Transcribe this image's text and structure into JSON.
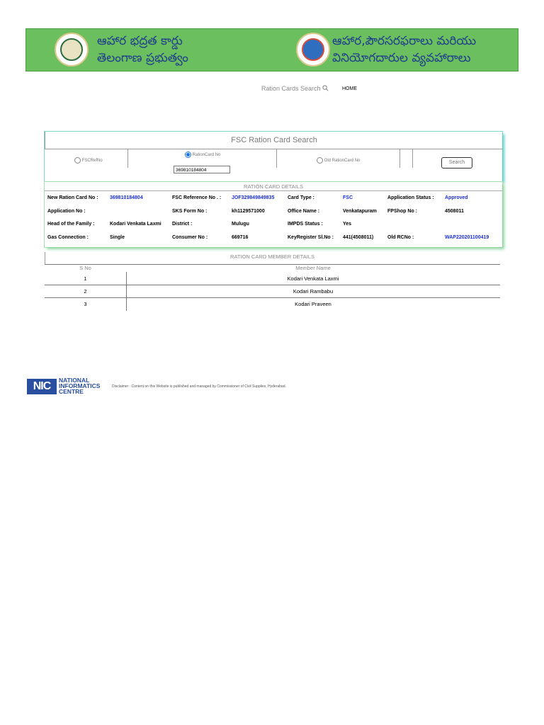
{
  "banner": {
    "left_title_line1": "ఆహార భద్రత కార్డు",
    "left_title_line2": "తెలంగాణ ప్రభుత్వం",
    "right_title_line1": "ఆహార,పౌరసరఫరాలు మరియు",
    "right_title_line2": "వినియోగదారుల వ్యవహారాలు",
    "bg_color": "#6bbf5f",
    "text_color": "#1f3d8c"
  },
  "nav": {
    "search_label": "Ration Cards Search",
    "search_icon": "search-icon",
    "home_label": "HOME"
  },
  "search_panel": {
    "title": "FSC Ration Card Search",
    "options": [
      {
        "label": "FSCRefNo",
        "selected": false
      },
      {
        "label": "RationCard No",
        "selected": true
      },
      {
        "label": "Old RationCard No",
        "selected": false
      }
    ],
    "input_value": "369810184804",
    "search_button": "Search"
  },
  "details": {
    "title": "RATION CARD DETAILS",
    "rows": [
      [
        {
          "label": "New Ration Card No :",
          "value": "369810184804",
          "blue": true
        },
        {
          "label": "FSC Reference No . :",
          "value": "JOF329849849835",
          "blue": true
        },
        {
          "label": "Card Type :",
          "value": "FSC",
          "blue": true
        },
        {
          "label": "Application Status :",
          "value": "Approved",
          "blue": true
        }
      ],
      [
        {
          "label": "Application No :",
          "value": ""
        },
        {
          "label": "SKS Form No :",
          "value": "kh1129571000"
        },
        {
          "label": "Office Name :",
          "value": "Venkatapuram"
        },
        {
          "label": "FPShop No :",
          "value": "4508011"
        }
      ],
      [
        {
          "label": "Head of the Family :",
          "value": "Kodari Venkata Laxmi"
        },
        {
          "label": "District :",
          "value": "Mulugu"
        },
        {
          "label": "IMPDS Status :",
          "value": "Yes"
        },
        {
          "label": "",
          "value": ""
        }
      ],
      [
        {
          "label": "Gas Connection :",
          "value": "Single"
        },
        {
          "label": "Consumer No :",
          "value": "669716"
        },
        {
          "label": "KeyRegister Sl.No :",
          "value": "441(4508011)"
        },
        {
          "label": "Old RCNo :",
          "value": "WAP220201100419",
          "blue": true
        }
      ]
    ]
  },
  "members": {
    "title": "RATION CARD MEMBER DETAILS",
    "col_sno": "S No",
    "col_name": "Member Name",
    "rows": [
      {
        "sno": "1",
        "name": "Kodari Venkata Laxmi"
      },
      {
        "sno": "2",
        "name": "Kodari Rambabu"
      },
      {
        "sno": "3",
        "name": "Kodari Praveen"
      }
    ]
  },
  "footer": {
    "logo_text": "NIC",
    "org_line1": "NATIONAL",
    "org_line2": "INFORMATICS",
    "org_line3": "CENTRE",
    "disclaimer": "Disclaimer : Content on this Website is published and managed by Commissioner of Civil Supplies, Hyderabad."
  }
}
